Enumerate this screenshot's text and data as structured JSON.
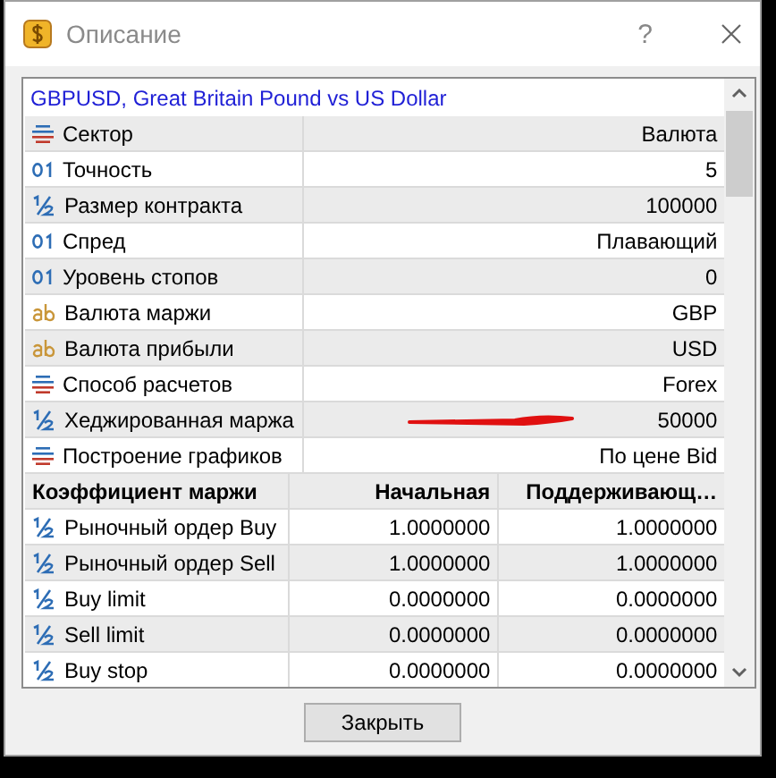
{
  "window": {
    "title": "Описание",
    "help": "?"
  },
  "symbol": "GBPUSD, Great Britain Pound vs US Dollar",
  "properties": [
    {
      "kind": "list",
      "name": "Сектор",
      "value": "Валюта"
    },
    {
      "kind": "digits",
      "name": "Точность",
      "value": "5"
    },
    {
      "kind": "fraction",
      "name": "Размер контракта",
      "value": "100000"
    },
    {
      "kind": "digits",
      "name": "Спред",
      "value": "Плавающий"
    },
    {
      "kind": "digits",
      "name": "Уровень стопов",
      "value": "0"
    },
    {
      "kind": "text",
      "name": "Валюта маржи",
      "value": "GBP"
    },
    {
      "kind": "text",
      "name": "Валюта прибыли",
      "value": "USD"
    },
    {
      "kind": "list",
      "name": "Способ расчетов",
      "value": "Forex"
    },
    {
      "kind": "fraction",
      "name": "Хеджированная маржа",
      "value": "50000"
    },
    {
      "kind": "list",
      "name": "Построение графиков",
      "value": "По цене Bid"
    }
  ],
  "margin_table": {
    "columns": [
      "Коэффициент маржи",
      "Начальная",
      "Поддерживающ…"
    ],
    "rows": [
      {
        "name": "Рыночный ордер Buy",
        "initial": "1.0000000",
        "maintenance": "1.0000000"
      },
      {
        "name": "Рыночный ордер Sell",
        "initial": "1.0000000",
        "maintenance": "1.0000000"
      },
      {
        "name": "Buy limit",
        "initial": "0.0000000",
        "maintenance": "0.0000000"
      },
      {
        "name": "Sell limit",
        "initial": "0.0000000",
        "maintenance": "0.0000000"
      },
      {
        "name": "Buy stop",
        "initial": "0.0000000",
        "maintenance": "0.0000000"
      }
    ]
  },
  "buttons": [
    "Закрыть"
  ]
}
